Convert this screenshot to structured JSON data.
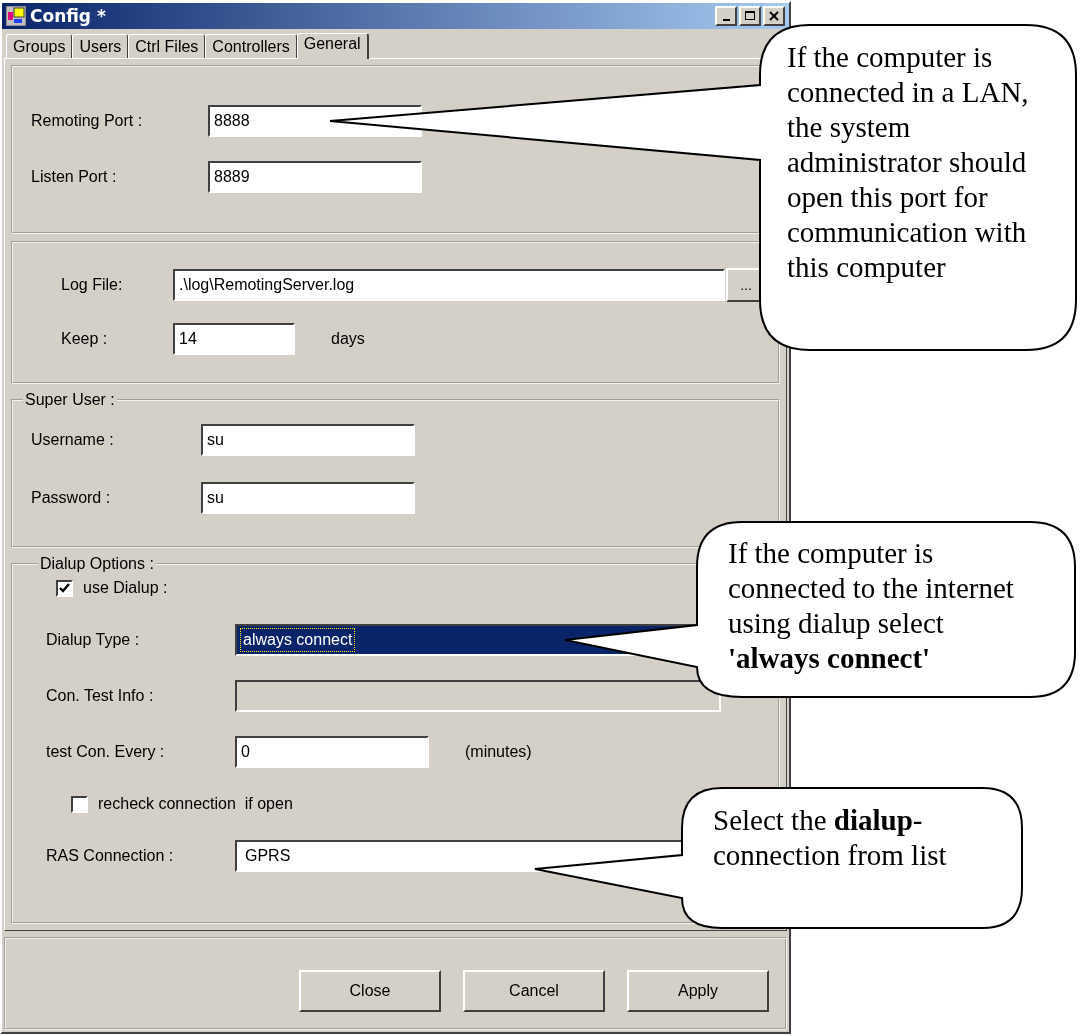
{
  "window": {
    "title": "Config *"
  },
  "tabs": [
    {
      "label": "Groups",
      "selected": false
    },
    {
      "label": "Users",
      "selected": false
    },
    {
      "label": "Ctrl Files",
      "selected": false
    },
    {
      "label": "Controllers",
      "selected": false
    },
    {
      "label": "General",
      "selected": true
    }
  ],
  "ports": [
    {
      "label": "Remoting Port :",
      "value": "8888"
    },
    {
      "label": "Listen Port :",
      "value": "8889"
    }
  ],
  "log": {
    "label": "Log File:",
    "value": ".\\log\\RemotingServer.log",
    "browse": "...",
    "keep_label": "Keep :",
    "keep_value": "14",
    "keep_unit": "days"
  },
  "super_user": {
    "title": "Super User :",
    "fields": [
      {
        "label": "Username :",
        "value": "su"
      },
      {
        "label": "Password :",
        "value": "su"
      }
    ]
  },
  "dialup": {
    "title": "Dialup Options :",
    "use_dialup": {
      "label": "use Dialup :",
      "checked": true
    },
    "dialup_type": {
      "label": "Dialup Type :",
      "value": "always connect",
      "selected": true
    },
    "con_test_info": {
      "label": "Con. Test Info :",
      "disabled": true
    },
    "test_every": {
      "label": "test Con. Every :",
      "value": "0",
      "unit": "(minutes)"
    },
    "recheck": {
      "label": "recheck connection  if open",
      "checked": false
    },
    "ras": {
      "label": "RAS Connection :",
      "value": "GPRS"
    }
  },
  "buttons": [
    "Close",
    "Cancel",
    "Apply"
  ],
  "callouts": [
    {
      "text": "If the computer is connected in a LAN, the system administrator should open this port for communication with this computer"
    },
    {
      "text": "If the computer is connected to the internet using dialup select **'always connect'**"
    },
    {
      "text": "Select the **dialup**-connection from list"
    }
  ]
}
